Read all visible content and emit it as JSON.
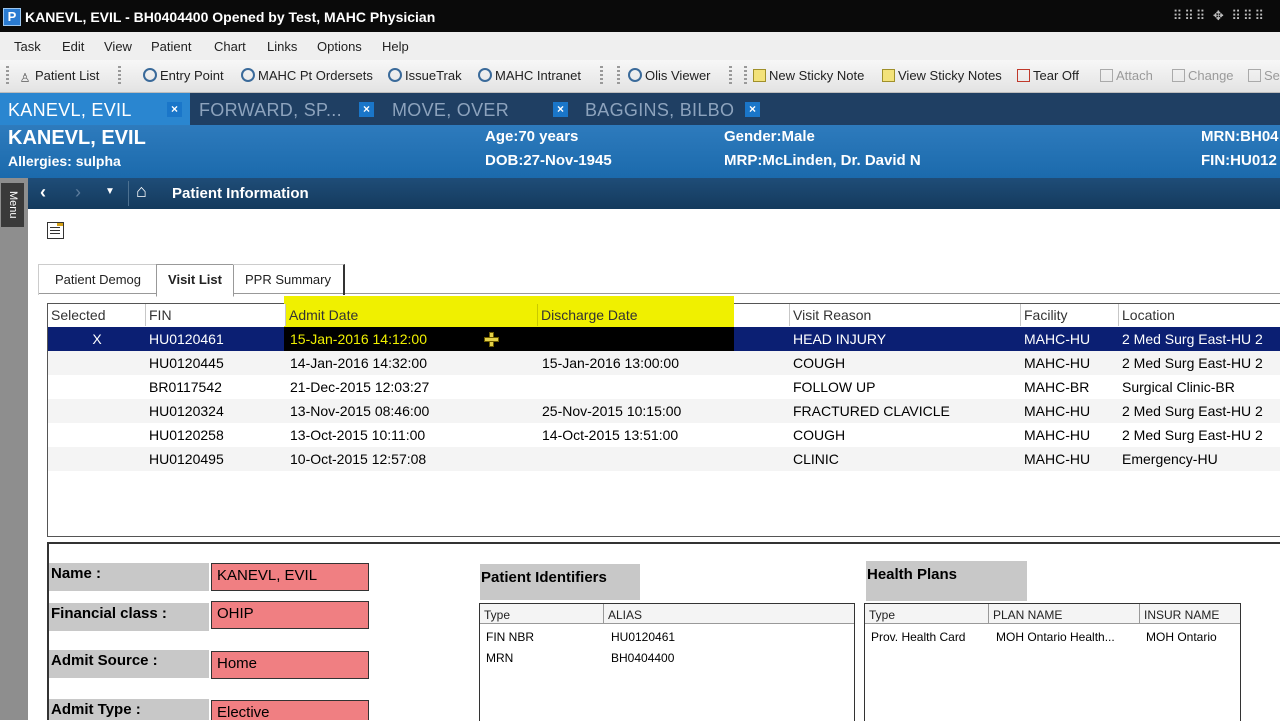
{
  "window": {
    "app_icon": "P",
    "title": "KANEVL, EVIL - BH0404400 Opened by Test, MAHC Physician"
  },
  "menu": [
    "Task",
    "Edit",
    "View",
    "Patient",
    "Chart",
    "Links",
    "Options",
    "Help"
  ],
  "toolbar": {
    "patient_list": "Patient List",
    "entry_point": "Entry Point",
    "mahc_orders": "MAHC Pt Ordersets",
    "issuetrak": "IssueTrak",
    "intranet": "MAHC Intranet",
    "olis": "Olis Viewer",
    "new_sticky": "New Sticky Note",
    "view_sticky": "View Sticky Notes",
    "tear_off": "Tear Off",
    "attach": "Attach",
    "change": "Change",
    "trailing": "Se"
  },
  "patient_tabs": [
    {
      "label": "KANEVL, EVIL",
      "active": true
    },
    {
      "label": "FORWARD, SP...",
      "active": false
    },
    {
      "label": "MOVE, OVER",
      "active": false
    },
    {
      "label": "BAGGINS, BILBO",
      "active": false
    }
  ],
  "banner": {
    "name": "KANEVL, EVIL",
    "allergies": "Allergies: sulpha",
    "age": "Age:70 years",
    "dob": "DOB:27-Nov-1945",
    "gender": "Gender:Male",
    "mrp": "MRP:McLinden, Dr. David N",
    "mrn": "MRN:BH04",
    "fin": "FIN:HU012"
  },
  "sidebar_menu_label": "Menu",
  "nav": {
    "title": "Patient Information"
  },
  "sub_tabs": [
    {
      "label": "Patient Demog",
      "active": false
    },
    {
      "label": "Visit List",
      "active": true
    },
    {
      "label": "PPR Summary",
      "active": false
    }
  ],
  "visit_grid": {
    "columns": [
      "Selected",
      "FIN",
      "Admit Date",
      "Discharge Date",
      "Visit Reason",
      "Facility",
      "Location"
    ],
    "rows": [
      {
        "selected": "X",
        "fin": "HU0120461",
        "admit": "15-Jan-2016 14:12:00",
        "discharge": "",
        "reason": "HEAD INJURY",
        "facility": "MAHC-HU",
        "location": "2 Med Surg East-HU 2"
      },
      {
        "selected": "",
        "fin": "HU0120445",
        "admit": "14-Jan-2016 14:32:00",
        "discharge": "15-Jan-2016 13:00:00",
        "reason": "COUGH",
        "facility": "MAHC-HU",
        "location": "2 Med Surg East-HU 2"
      },
      {
        "selected": "",
        "fin": "BR0117542",
        "admit": "21-Dec-2015 12:03:27",
        "discharge": "",
        "reason": "FOLLOW UP",
        "facility": "MAHC-BR",
        "location": "Surgical Clinic-BR"
      },
      {
        "selected": "",
        "fin": "HU0120324",
        "admit": "13-Nov-2015 08:46:00",
        "discharge": "25-Nov-2015 10:15:00",
        "reason": "FRACTURED CLAVICLE",
        "facility": "MAHC-HU",
        "location": "2 Med Surg East-HU 2"
      },
      {
        "selected": "",
        "fin": "HU0120258",
        "admit": "13-Oct-2015 10:11:00",
        "discharge": "14-Oct-2015 13:51:00",
        "reason": "COUGH",
        "facility": "MAHC-HU",
        "location": "2 Med Surg East-HU 2"
      },
      {
        "selected": "",
        "fin": "HU0120495",
        "admit": "10-Oct-2015 12:57:08",
        "discharge": "",
        "reason": "CLINIC",
        "facility": "MAHC-HU",
        "location": "Emergency-HU"
      }
    ]
  },
  "details": {
    "name_label": "Name :",
    "name_value": "KANEVL, EVIL",
    "fin_class_label": "Financial class :",
    "fin_class_value": "OHIP",
    "admit_source_label": "Admit Source :",
    "admit_source_value": "Home",
    "admit_type_label": "Admit Type :",
    "admit_type_value": "Elective"
  },
  "identifiers": {
    "title": "Patient Identifiers",
    "headers": [
      "Type",
      "ALIAS"
    ],
    "rows": [
      {
        "type": "FIN NBR",
        "alias": "HU0120461"
      },
      {
        "type": "MRN",
        "alias": "BH0404400"
      }
    ]
  },
  "health_plans": {
    "title": "Health Plans",
    "headers": [
      "Type",
      "PLAN NAME",
      "INSUR NAME"
    ],
    "rows": [
      {
        "type": "Prov. Health Card",
        "plan": "MOH Ontario Health...",
        "insur": "MOH Ontario"
      }
    ]
  },
  "colors": {
    "selected_row": "#0b1f73",
    "highlight": "#f0f000",
    "field_value": "#f07f82",
    "banner": "#2e7bbd"
  }
}
